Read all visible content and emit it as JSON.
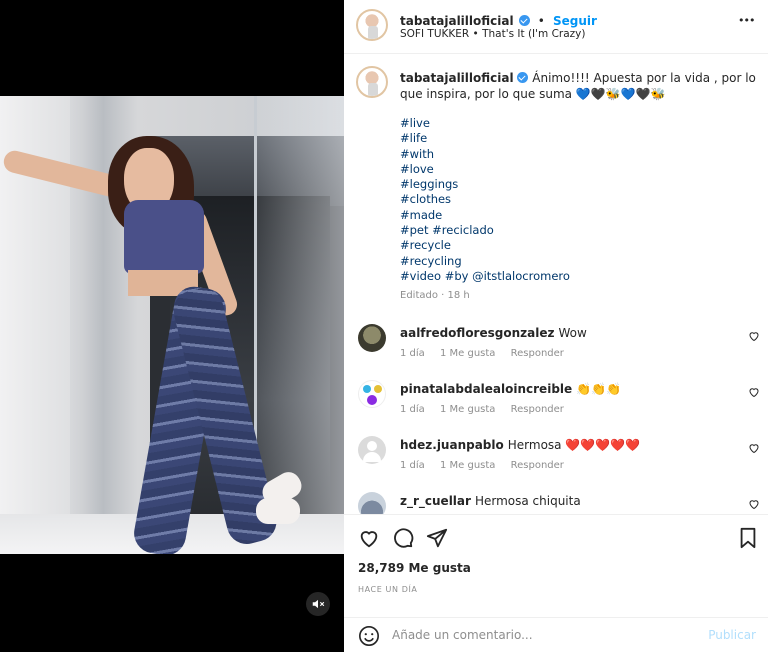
{
  "post": {
    "username": "tabatajalilloficial",
    "follow_label": "Seguir",
    "audio": "SOFI TUKKER • That's It (I'm Crazy)",
    "more_label": "•••"
  },
  "caption": {
    "username": "tabatajalilloficial",
    "text": "Ánimo!!!! Apuesta por la vida , por lo que inspira, por lo que suma 💙🖤🐝💙🖤🐝",
    "hashtags": [
      "#live",
      "#life",
      "#with",
      "#love",
      "#leggings",
      "#clothes",
      "#made",
      "#pet #reciclado",
      "#recycle",
      "#recycling",
      "#video #by @itstlalocromero"
    ],
    "edited": "Editado · 18 h"
  },
  "comments": [
    {
      "user": "aalfredofloresgonzalez",
      "text": "Wow",
      "time": "1 día",
      "likes": "1 Me gusta",
      "reply": "Responder"
    },
    {
      "user": "pinatalabdalealoincreible",
      "text": "👏👏👏",
      "time": "1 día",
      "likes": "1 Me gusta",
      "reply": "Responder"
    },
    {
      "user": "hdez.juanpablo",
      "text": "Hermosa ❤️❤️❤️❤️❤️",
      "time": "1 día",
      "likes": "1 Me gusta",
      "reply": "Responder"
    },
    {
      "user": "z_r_cuellar",
      "text": "Hermosa chiquita"
    }
  ],
  "actions": {
    "likes": "28,789 Me gusta",
    "ago": "HACE UN DÍA",
    "icons": [
      "heart-icon",
      "comment-icon",
      "share-icon",
      "bookmark-icon"
    ]
  },
  "add_comment": {
    "placeholder": "Añade un comentario...",
    "post_label": "Publicar"
  },
  "colors": {
    "accent": "#0095f6",
    "hashtag": "#00376b",
    "muted": "#8e8e8e"
  }
}
